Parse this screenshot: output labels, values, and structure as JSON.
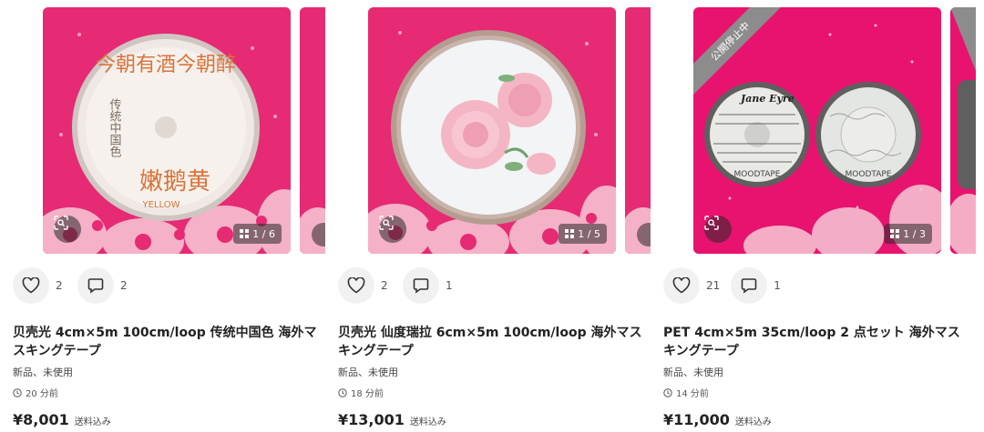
{
  "colors": {
    "brand_pink": "#e62a73",
    "overlay": "#282828",
    "ribbon_gray": "#8c8c8c"
  },
  "items": [
    {
      "image_counter": "1 / 6",
      "status_ribbon": "",
      "tape_text": [
        "今朝有酒今朝醉",
        "传统中国色",
        "嫩鹅黄",
        "YELLOW"
      ],
      "likes": "2",
      "comments": "2",
      "title": "贝壳光 4cm×5m 100cm/loop 传统中国色 海外マスキングテープ",
      "condition": "新品、未使用",
      "time": "20 分前",
      "price": "¥8,001",
      "shipping": "送料込み"
    },
    {
      "image_counter": "1 / 5",
      "status_ribbon": "",
      "tape_text": [],
      "likes": "2",
      "comments": "1",
      "title": "贝壳光 仙度瑞拉 6cm×5m 100cm/loop 海外マスキングテープ",
      "condition": "新品、未使用",
      "time": "18 分前",
      "price": "¥13,001",
      "shipping": "送料込み"
    },
    {
      "image_counter": "1 / 3",
      "status_ribbon": "公開停止中",
      "tape_text": [
        "Jane Eyre",
        "MOODTAPE",
        "MOODTAPE"
      ],
      "likes": "21",
      "comments": "1",
      "title": "PET 4cm×5m 35cm/loop 2 点セット 海外マスキングテープ",
      "condition": "新品、未使用",
      "time": "14 分前",
      "price": "¥11,000",
      "shipping": "送料込み"
    }
  ],
  "icons": {
    "like": "heart-icon",
    "comment": "comment-icon",
    "zoom": "lens-search-icon",
    "gallery": "gallery-grid-icon",
    "time": "clock-icon"
  }
}
